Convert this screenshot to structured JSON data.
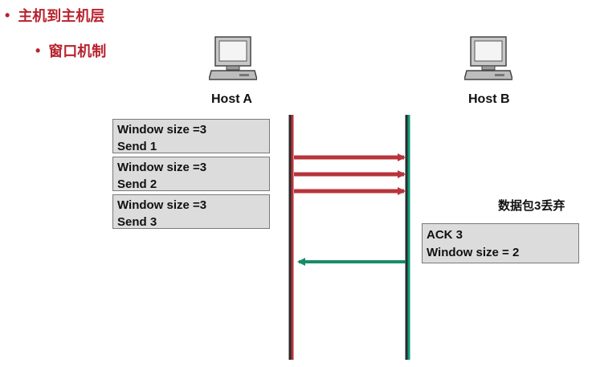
{
  "titles": {
    "level1": "主机到主机层",
    "level2": "窗口机制",
    "bullet": "•"
  },
  "hosts": {
    "a": "Host A",
    "b": "Host B"
  },
  "send_boxes": [
    {
      "line1": "Window size =3",
      "line2": "Send 1"
    },
    {
      "line1": "Window size =3",
      "line2": "Send 2"
    },
    {
      "line1": "Window size =3",
      "line2": "Send 3"
    }
  ],
  "lost_label": "数据包3丢弃",
  "ack_box": {
    "line1": "ACK 3",
    "line2": "Window size = 2"
  },
  "colors": {
    "title": "#b8232e",
    "host_a_line": "#b8343a",
    "host_b_line": "#0f9a78",
    "send_arrow": "#b8343a",
    "ack_arrow": "#1a8a6a",
    "box_fill": "#dcdcdc"
  },
  "icons": [
    "computer-icon",
    "computer-icon"
  ]
}
